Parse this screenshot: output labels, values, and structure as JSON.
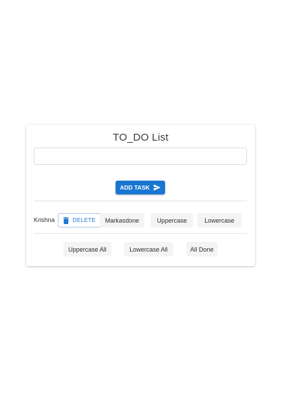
{
  "app": {
    "title": "TO_DO List"
  },
  "task_input": {
    "value": "",
    "placeholder": ""
  },
  "add_button": {
    "label": "ADD TASK",
    "icon": "send-icon",
    "color": "#1976d2"
  },
  "tasks": [
    {
      "name": "Krishna",
      "delete_label": "DELETE",
      "delete_icon": "trash-icon",
      "mark_done_label": "Markasdone",
      "uppercase_label": "Uppercase",
      "lowercase_label": "Lowercase"
    }
  ],
  "bulk_actions": {
    "uppercase_all_label": "Uppercase All",
    "lowercase_all_label": "Lowercase All",
    "all_done_label": "All Done"
  }
}
